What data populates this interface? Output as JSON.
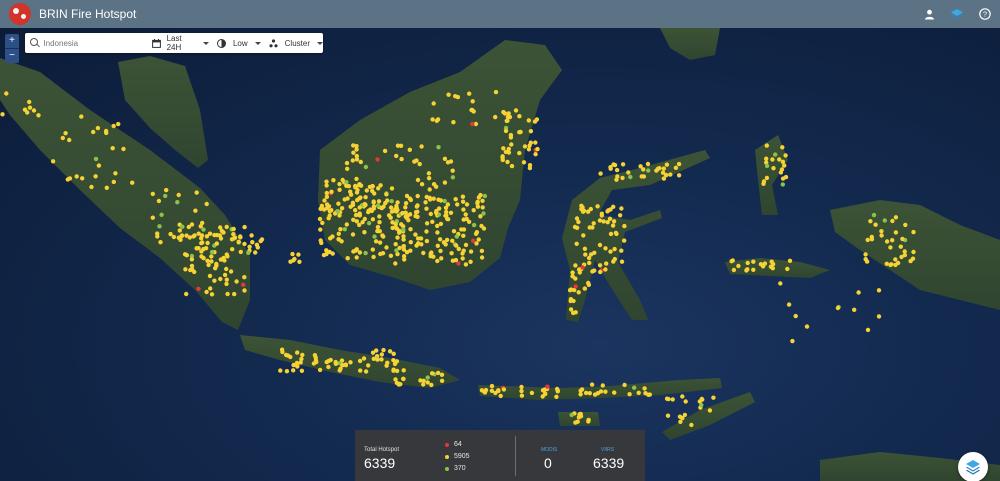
{
  "header": {
    "app_title": "BRIN Fire Hotspot",
    "icons": [
      "user-icon",
      "layers-icon",
      "help-icon"
    ]
  },
  "zoom": {
    "in_label": "+",
    "out_label": "−"
  },
  "search": {
    "value": "",
    "placeholder": "Indonesia"
  },
  "filters": {
    "time": {
      "icon": "calendar-icon",
      "value": "Last 24H"
    },
    "confidence": {
      "icon": "confidence-icon",
      "value": "Low"
    },
    "view": {
      "icon": "cluster-icon",
      "value": "Cluster"
    }
  },
  "summary": {
    "total_label": "Total Hotspot",
    "total_value": "6339",
    "levels": [
      {
        "color": "#e53935",
        "count": "64"
      },
      {
        "color": "#f6d234",
        "count": "5905"
      },
      {
        "color": "#8bc34a",
        "count": "370"
      }
    ],
    "sources": [
      {
        "label": "MODIS",
        "value": "0"
      },
      {
        "label": "VIIRS",
        "value": "6339"
      }
    ]
  },
  "colors": {
    "topbar": "#5b7384",
    "sea": "#132a4f",
    "land": "#3a4e34",
    "hotspot_high": "#e53935",
    "hotspot_medium": "#f6d234",
    "hotspot_low": "#8bc34a"
  },
  "map_layer_button_icon": "layers-icon"
}
